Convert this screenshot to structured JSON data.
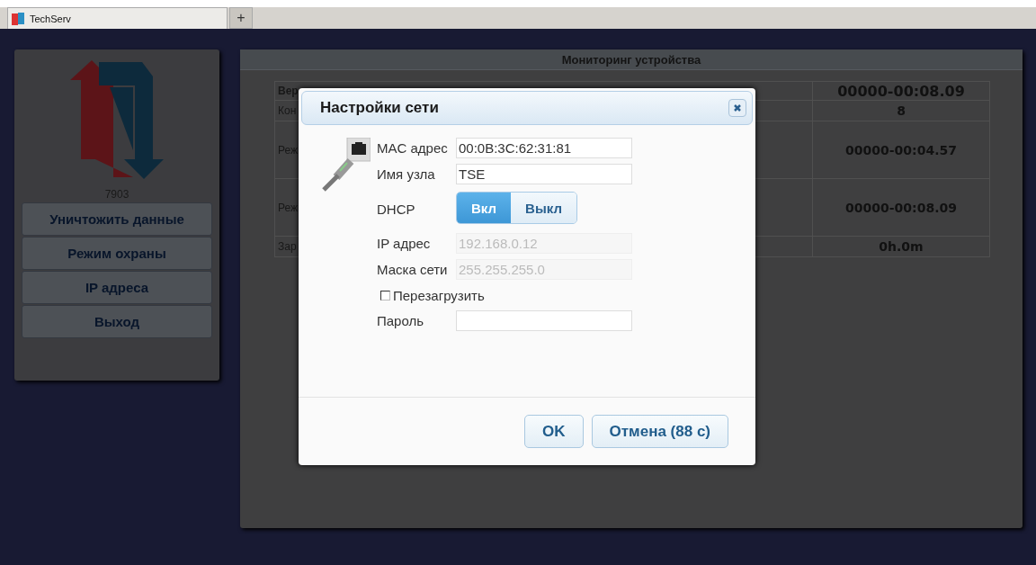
{
  "browser": {
    "tabs": [
      {
        "label": "TechServ",
        "selected": true
      }
    ],
    "new_tab_button": "+"
  },
  "sidebar": {
    "device_id": "7903",
    "buttons": [
      "Уничтожить данные",
      "Режим охраны",
      "IP адреса",
      "Выход"
    ]
  },
  "monitor": {
    "title": "Мониторинг устройства",
    "rows": [
      {
        "kind": "header",
        "label": "Вер",
        "value": "00000-00:08.09"
      },
      {
        "kind": "short",
        "label": "Кон",
        "value": "8"
      },
      {
        "kind": "tall",
        "label": "Реж",
        "value": "00000-00:04.57"
      },
      {
        "kind": "tall",
        "label": "Реж",
        "value": "00000-00:08.09"
      },
      {
        "kind": "short",
        "label": "Зар",
        "value": "0h.0m"
      }
    ]
  },
  "dialog": {
    "title": "Настройки сети",
    "fields": [
      {
        "kind": "text",
        "label": "MAC адрес",
        "value": "00:0B:3C:62:31:81",
        "disabled": false
      },
      {
        "kind": "text",
        "label": "Имя узла",
        "value": "TSE",
        "disabled": false
      },
      {
        "kind": "toggle",
        "label": "DHCP",
        "options": [
          {
            "label": "Вкл",
            "selected": true
          },
          {
            "label": "Выкл",
            "selected": false
          }
        ]
      },
      {
        "kind": "text",
        "label": "IP адрес",
        "value": "192.168.0.12",
        "disabled": true
      },
      {
        "kind": "text",
        "label": "Маска сети",
        "value": "255.255.255.0",
        "disabled": true
      },
      {
        "kind": "checkbox",
        "label": "Перезагрузить",
        "checked": false
      },
      {
        "kind": "text",
        "label": "Пароль",
        "disabled": false
      }
    ],
    "buttons": [
      "OK",
      "Отмена (88 с)"
    ]
  }
}
